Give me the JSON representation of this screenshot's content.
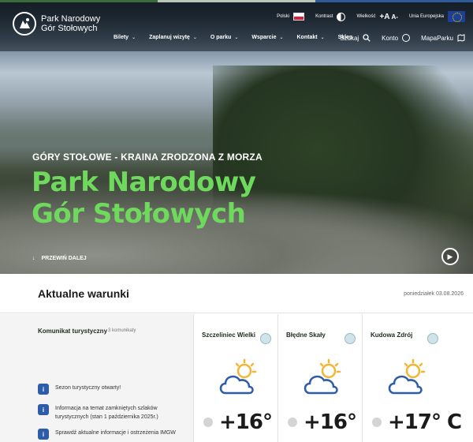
{
  "header": {
    "logo_line1": "Park Narodowy",
    "logo_line2": "Gór Stołowych",
    "language": "Polski",
    "contrast_label": "Kontrast",
    "size_label": "Wielkość",
    "size_plus": "+A",
    "size_minus": "A-",
    "eu_label": "Unia Europejska"
  },
  "nav": {
    "items": [
      {
        "label": "Bilety"
      },
      {
        "label": "Zaplanuj wizytę"
      },
      {
        "label": "O parku"
      },
      {
        "label": "Wsparcie"
      },
      {
        "label": "Kontakt"
      },
      {
        "label": "Sklep"
      }
    ],
    "search": "Szukaj",
    "account": "Konto",
    "map": "MapaParku"
  },
  "hero": {
    "subtitle": "GÓRY STOŁOWE - KRAINA ZRODZONA Z MORZA",
    "title": "Park Narodowy Gór Stołowych",
    "scroll_label": "PRZEWIŃ DALEJ"
  },
  "conditions": {
    "title": "Aktualne warunki",
    "date": "poniedziałek 03.08.2026",
    "communique_title": "Komunikat turystyczny",
    "communique_count": "3 komunikaty",
    "notices": [
      "Sezon turystyczny otwarty!",
      "Informacja na temat zamkniętych szlaków turystycznych (stan 1 października 2025r.)",
      "Sprawdź aktualne informacje i ostrzeżenia IMGW"
    ],
    "locations": [
      {
        "name": "Szczeliniec Wielki",
        "temp": "+16° C",
        "icon": "sun-cloud-icon"
      },
      {
        "name": "Błędne Skały",
        "temp": "+16° C",
        "icon": "sun-cloud-icon"
      },
      {
        "name": "Kudowa Zdrój",
        "temp": "+17° C",
        "icon": "sun-cloud-icon"
      }
    ]
  },
  "colors": {
    "accent_green": "#6ed95c",
    "info_blue": "#2d5ca8",
    "cloud_blue": "#2d5ca8",
    "sun_yellow": "#f2b632"
  }
}
